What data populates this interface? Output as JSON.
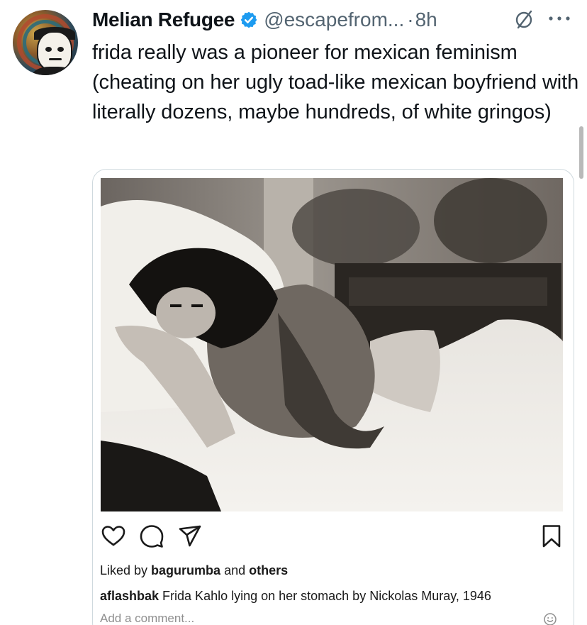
{
  "tweet": {
    "display_name": "Melian Refugee",
    "handle": "@escapefrom...",
    "separator": "·",
    "time": "8h",
    "text": "frida really was a pioneer for mexican feminism (cheating on her ugly toad-like mexican boyfriend with literally dozens, maybe hundreds, of white gringos)"
  },
  "icons": {
    "verified": "verified-badge-icon",
    "grok": "grok-icon",
    "more": "more-options-icon",
    "like": "heart-icon",
    "comment": "comment-bubble-icon",
    "share": "send-icon",
    "save": "bookmark-icon",
    "emoji": "emoji-icon"
  },
  "embed": {
    "liked_prefix": "Liked by ",
    "liked_user": "bagurumba",
    "liked_and": " and ",
    "liked_others": "others",
    "caption_user": "aflashbak",
    "caption_text": " Frida Kahlo lying on her stomach by Nickolas Muray, 1946",
    "comment_placeholder": "Add a comment..."
  },
  "colors": {
    "text": "#0f1419",
    "secondary": "#536471",
    "verified": "#1d9bf0",
    "border": "#cfd9de"
  }
}
